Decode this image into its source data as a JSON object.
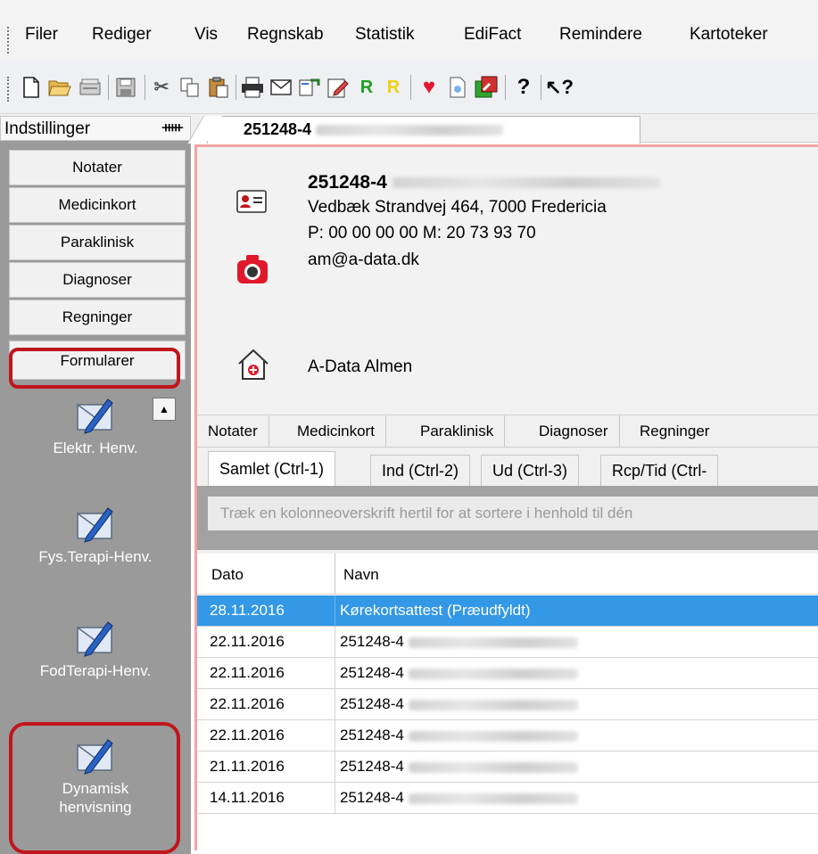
{
  "menu": [
    "Filer",
    "Rediger",
    "Vis",
    "Regnskab",
    "Statistik",
    "EdiFact",
    "Remindere",
    "Kartoteker"
  ],
  "toolbar_icons": [
    "new-document-icon",
    "open-folder-icon",
    "scanner-icon",
    "save-icon",
    "cut-icon",
    "copy-icon",
    "paste-icon",
    "print-icon",
    "mail-icon",
    "phone-icon",
    "edit-icon",
    "r-green-icon",
    "r-yellow-icon",
    "heart-icon",
    "document-icon",
    "export-icon",
    "help-icon",
    "whats-this-icon"
  ],
  "left_panel": {
    "title": "Indstillinger",
    "pin": "И",
    "buttons": [
      "Notater",
      "Medicinkort",
      "Paraklinisk",
      "Diagnoser",
      "Regninger",
      "Formularer"
    ],
    "shortcuts": [
      {
        "label": "Elektr. Henv."
      },
      {
        "label": "Fys.Terapi-Henv."
      },
      {
        "label": "FodTerapi-Henv."
      },
      {
        "label": "Dynamisk henvisning"
      }
    ]
  },
  "doc_tab": {
    "title": "251248-4"
  },
  "patient": {
    "name": "251248-4",
    "address": "Vedbæk Strandvej 464, 7000 Fredericia",
    "phone": "P: 00 00 00 00 M: 20 73 93 70",
    "email": "am@a-data.dk",
    "clinic": "A-Data Almen"
  },
  "tabs_primary": [
    "Notater",
    "Medicinkort",
    "Paraklinisk",
    "Diagnoser",
    "Regninger"
  ],
  "tabs_secondary": [
    "Samlet (Ctrl-1)",
    "Ind (Ctrl-2)",
    "Ud (Ctrl-3)",
    "Rcp/Tid (Ctrl-"
  ],
  "group_hint": "Træk en kolonneoverskrift hertil for at sortere i henhold til dén",
  "grid": {
    "columns": [
      "Dato",
      "Navn"
    ],
    "rows": [
      {
        "date": "28.11.2016",
        "name": "Kørekortsattest (Præudfyldt)"
      },
      {
        "date": "22.11.2016",
        "name": "251248-4"
      },
      {
        "date": "22.11.2016",
        "name": "251248-4"
      },
      {
        "date": "22.11.2016",
        "name": "251248-4"
      },
      {
        "date": "22.11.2016",
        "name": "251248-4"
      },
      {
        "date": "21.11.2016",
        "name": "251248-4"
      },
      {
        "date": "14.11.2016",
        "name": "251248-4"
      }
    ]
  },
  "colors": {
    "selection": "#3398e6",
    "highlight": "#c0161c",
    "panel": "#9a9a9a"
  }
}
